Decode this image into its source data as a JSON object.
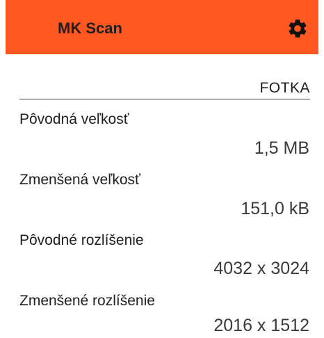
{
  "app_bar": {
    "title": "MK Scan",
    "settings_icon": "gear-icon",
    "color": "#ff5722"
  },
  "section": {
    "header": "FOTKA"
  },
  "rows": [
    {
      "label": "Pôvodná veľkosť",
      "value": "1,5 MB"
    },
    {
      "label": "Zmenšená veľkosť",
      "value": "151,0 kB"
    },
    {
      "label": "Pôvodné rozlíšenie",
      "value": "4032 x 3024"
    },
    {
      "label": "Zmenšené rozlíšenie",
      "value": "2016 x 1512"
    }
  ]
}
